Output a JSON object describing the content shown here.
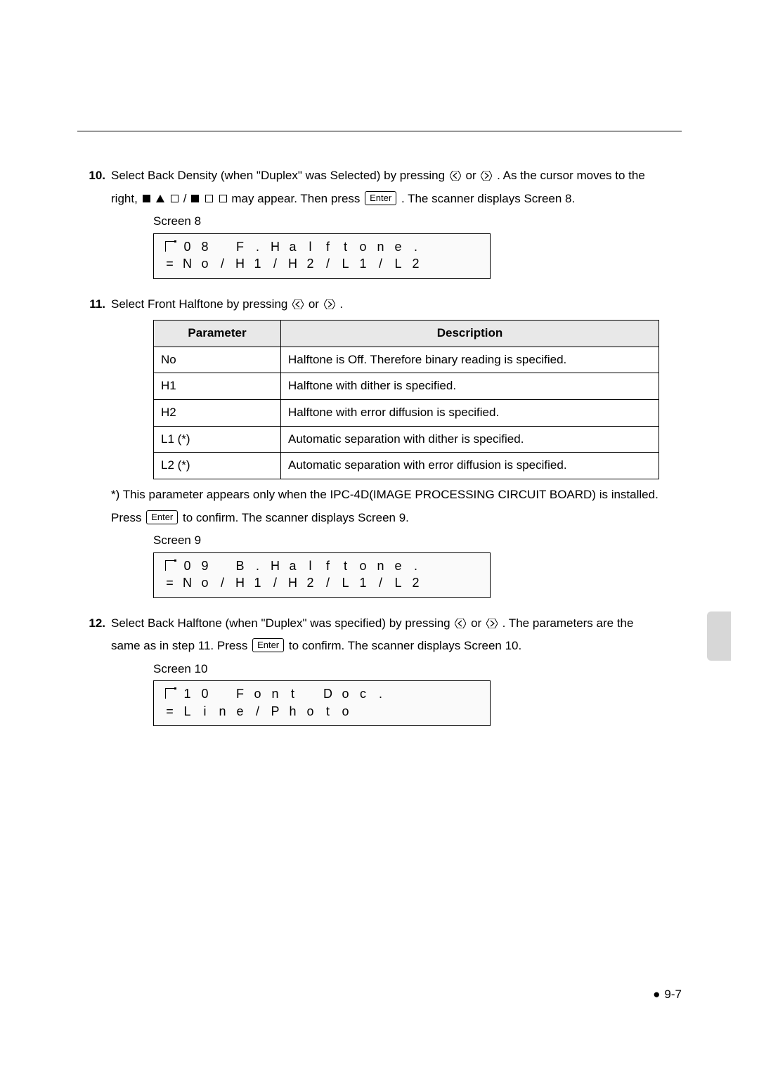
{
  "step10": {
    "num": "10.",
    "line1a": "Select Back Density (when \"Duplex\" was Selected) by pressing ",
    "line1b": " or ",
    "line1c": " . As the cursor moves to the",
    "line2a": "right, ",
    "line2b": " / ",
    "line2c": " may appear. Then press ",
    "line2d": " . The scanner displays Screen 8.",
    "enter": "Enter"
  },
  "screen8": {
    "label": "Screen 8",
    "row1": [
      "",
      "0",
      "8",
      "",
      "F",
      ".",
      "H",
      "a",
      "l",
      "f",
      "t",
      "o",
      "n",
      "e",
      ".",
      ""
    ],
    "row2": [
      "=",
      "N",
      "o",
      "/",
      "H",
      "1",
      "/",
      "H",
      "2",
      "/",
      "L",
      "1",
      "/",
      "L",
      "2",
      ""
    ]
  },
  "step11": {
    "num": "11.",
    "textA": "Select Front Halftone by pressing ",
    "textB": " or ",
    "textC": " ."
  },
  "table": {
    "h1": "Parameter",
    "h2": "Description",
    "rows": [
      {
        "p": "No",
        "d": "Halftone is Off. Therefore binary reading is specified."
      },
      {
        "p": "H1",
        "d": "Halftone with dither is specified."
      },
      {
        "p": "H2",
        "d": "Halftone with error diffusion is specified."
      },
      {
        "p": "L1 (*)",
        "d": "Automatic separation with dither is specified."
      },
      {
        "p": "L2 (*)",
        "d": "Automatic separation with error diffusion is specified."
      }
    ]
  },
  "footnote": "*) This parameter appears only when the IPC-4D(IMAGE PROCESSING CIRCUIT BOARD) is installed.",
  "afterTable": {
    "a": "Press ",
    "b": " to confirm. The scanner displays Screen 9.",
    "enter": "Enter"
  },
  "screen9": {
    "label": "Screen 9",
    "row1": [
      "",
      "0",
      "9",
      "",
      "B",
      ".",
      "H",
      "a",
      "l",
      "f",
      "t",
      "o",
      "n",
      "e",
      ".",
      ""
    ],
    "row2": [
      "=",
      "N",
      "o",
      "/",
      "H",
      "1",
      "/",
      "H",
      "2",
      "/",
      "L",
      "1",
      "/",
      "L",
      "2",
      ""
    ]
  },
  "step12": {
    "num": "12.",
    "a": "Select Back Halftone (when \"Duplex\" was specified) by pressing ",
    "b": " or ",
    "c": " . The parameters are the",
    "d": "same as in step 11. Press ",
    "e": " to confirm. The scanner displays Screen 10.",
    "enter": "Enter"
  },
  "screen10": {
    "label": "Screen 10",
    "row1": [
      "",
      "1",
      "0",
      "",
      "F",
      "o",
      "n",
      "t",
      "",
      "D",
      "o",
      "c",
      ".",
      "",
      "",
      ""
    ],
    "row2": [
      "=",
      "L",
      "i",
      "n",
      "e",
      "/",
      "P",
      "h",
      "o",
      "t",
      "o",
      "",
      "",
      "",
      "",
      ""
    ]
  },
  "pageNumber": "9-7"
}
